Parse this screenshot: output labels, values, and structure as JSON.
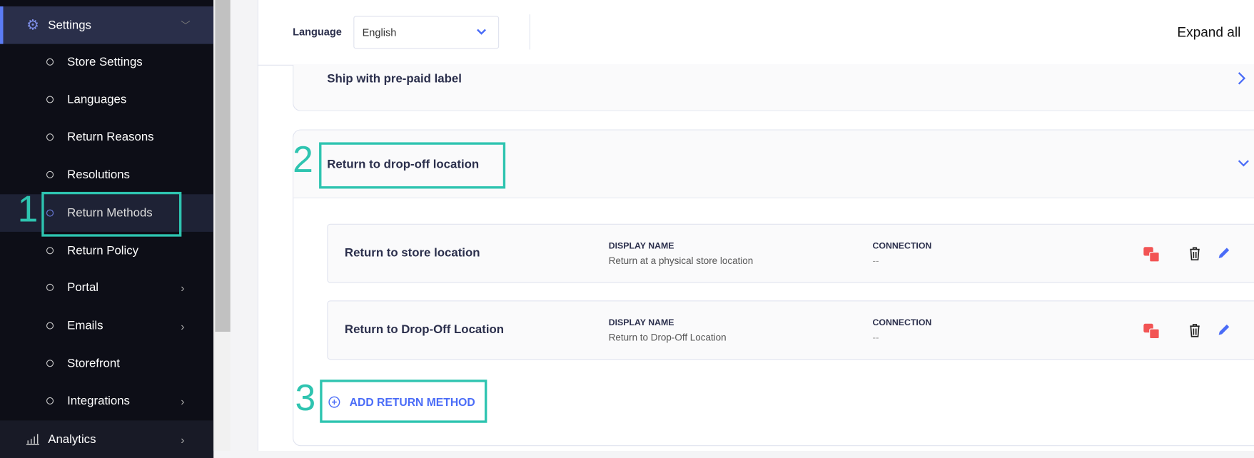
{
  "sidebar": {
    "settings": {
      "label": "Settings",
      "icon": "gear-icon"
    },
    "items": [
      {
        "label": "Store Settings"
      },
      {
        "label": "Languages"
      },
      {
        "label": "Return Reasons"
      },
      {
        "label": "Resolutions"
      },
      {
        "label": "Return Methods",
        "active": true
      },
      {
        "label": "Return Policy"
      },
      {
        "label": "Portal",
        "has_submenu": true
      },
      {
        "label": "Emails",
        "has_submenu": true
      },
      {
        "label": "Storefront"
      },
      {
        "label": "Integrations",
        "has_submenu": true
      }
    ],
    "analytics": {
      "label": "Analytics",
      "icon": "bar-chart-icon"
    }
  },
  "header": {
    "language_label": "Language",
    "language_value": "English",
    "expand_all": "Expand all"
  },
  "sections": [
    {
      "title": "Ship with pre-paid label",
      "expanded": false
    },
    {
      "title": "Return to drop-off location",
      "expanded": true,
      "methods": [
        {
          "name": "Return to store location",
          "display_name_label": "DISPLAY NAME",
          "display_name": "Return at a physical store location",
          "connection_label": "CONNECTION",
          "connection": "--"
        },
        {
          "name": "Return to Drop-Off Location",
          "display_name_label": "DISPLAY NAME",
          "display_name": "Return to Drop-Off Location",
          "connection_label": "CONNECTION",
          "connection": "--"
        }
      ],
      "add_label": "ADD RETURN METHOD"
    }
  ],
  "annotations": [
    "1",
    "2",
    "3"
  ],
  "colors": {
    "accent": "#4a6cf7",
    "annotation": "#2ec4b0",
    "translate": "#f25454",
    "sidebar": "#0d0e17"
  }
}
